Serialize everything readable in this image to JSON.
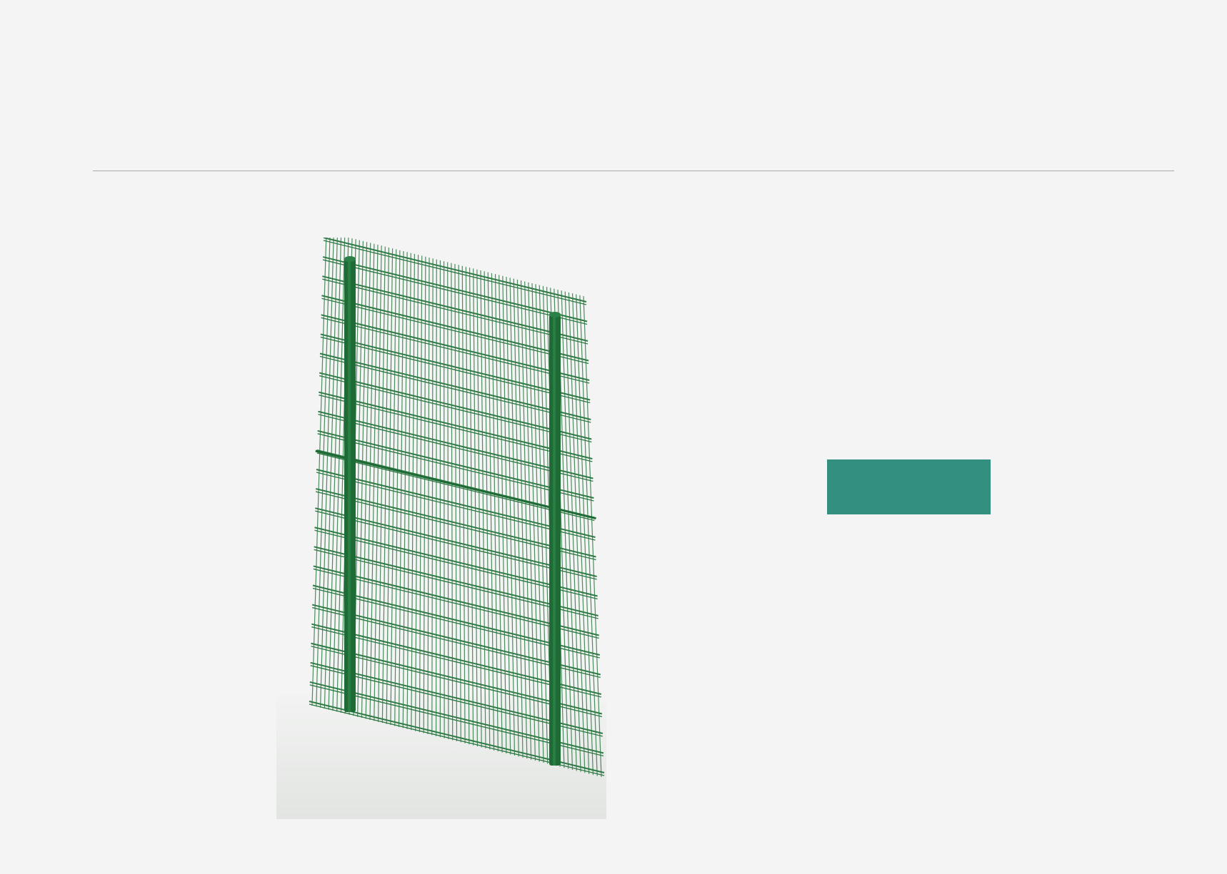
{
  "page": {
    "header_title": "",
    "background_color": "#f4f4f4"
  },
  "divider": {
    "color": "#a9a9a9"
  },
  "product_image": {
    "icon": "fence-panel-icon",
    "colors": {
      "mesh": "#2f7a45",
      "post": "#1e6b36",
      "floor": "#e2e4e2"
    }
  },
  "cta_button": {
    "label": "",
    "color": "#338f80"
  }
}
